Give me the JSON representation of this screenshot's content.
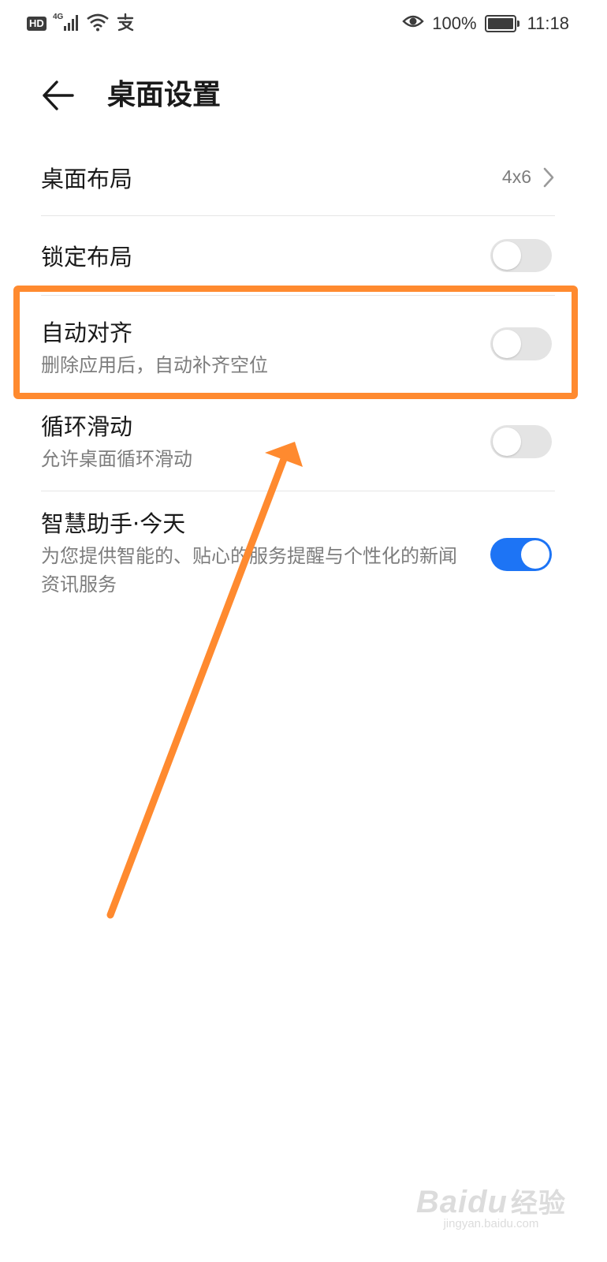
{
  "status_bar": {
    "hd_badge": "HD",
    "network_type": "4G",
    "battery_percent": "100%",
    "time": "11:18",
    "icons": [
      "hd-icon",
      "signal-icon",
      "wifi-icon",
      "alipay-icon",
      "eye-icon",
      "battery-charging-icon"
    ]
  },
  "header": {
    "back_icon": "arrow-left-icon",
    "title": "桌面设置"
  },
  "settings": {
    "layout": {
      "title": "桌面布局",
      "value": "4x6"
    },
    "lock_layout": {
      "title": "锁定布局",
      "enabled": false
    },
    "auto_align": {
      "title": "自动对齐",
      "subtitle": "删除应用后，自动补齐空位",
      "enabled": false
    },
    "loop_scroll": {
      "title": "循环滑动",
      "subtitle": "允许桌面循环滑动",
      "enabled": false
    },
    "assistant_today": {
      "title": "智慧助手·今天",
      "subtitle": "为您提供智能的、贴心的服务提醒与个性化的新闻资讯服务",
      "enabled": true
    }
  },
  "annotation": {
    "highlight_color": "#ff8a2f",
    "arrow_color": "#ff8a2f"
  },
  "colors": {
    "toggle_on": "#1d74f5",
    "toggle_off": "#e4e4e4"
  },
  "watermark": {
    "logo": "Baidu",
    "logo_cn": "经验",
    "url": "jingyan.baidu.com"
  }
}
